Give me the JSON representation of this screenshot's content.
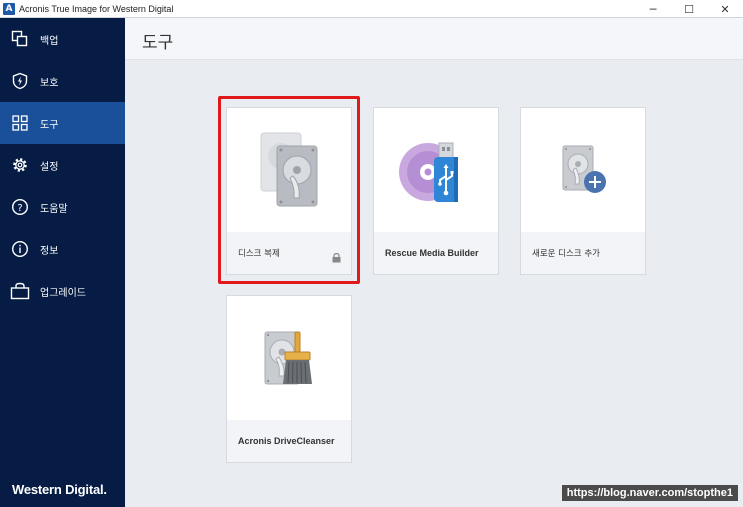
{
  "window": {
    "title": "Acronis True Image for Western Digital",
    "app_icon_letter": "A",
    "controls": {
      "minimize": "─",
      "maximize": "☐",
      "close": "✕"
    }
  },
  "sidebar": {
    "items": [
      {
        "label": "백업",
        "icon": "backup-icon"
      },
      {
        "label": "보호",
        "icon": "shield-icon"
      },
      {
        "label": "도구",
        "icon": "tools-grid-icon",
        "active": true
      },
      {
        "label": "설정",
        "icon": "gear-icon"
      },
      {
        "label": "도움말",
        "icon": "help-icon"
      },
      {
        "label": "정보",
        "icon": "info-icon"
      },
      {
        "label": "업그레이드",
        "icon": "upgrade-bag-icon"
      }
    ],
    "brand": "Western Digital."
  },
  "main": {
    "title": "도구",
    "tiles": [
      {
        "label": "디스크 복제",
        "icon": "disk-clone-icon",
        "locked": true
      },
      {
        "label": "Rescue Media Builder",
        "icon": "rescue-media-icon"
      },
      {
        "label": "새로운 디스크 추가",
        "icon": "add-disk-icon"
      },
      {
        "label": "Acronis DriveCleanser",
        "icon": "drive-cleanser-icon"
      }
    ]
  },
  "watermark": "https://blog.naver.com/stopthe1",
  "colors": {
    "sidebar_bg": "#061c45",
    "sidebar_active": "#1a4f99",
    "highlight": "#e0191b",
    "main_bg": "#e9edf2"
  }
}
